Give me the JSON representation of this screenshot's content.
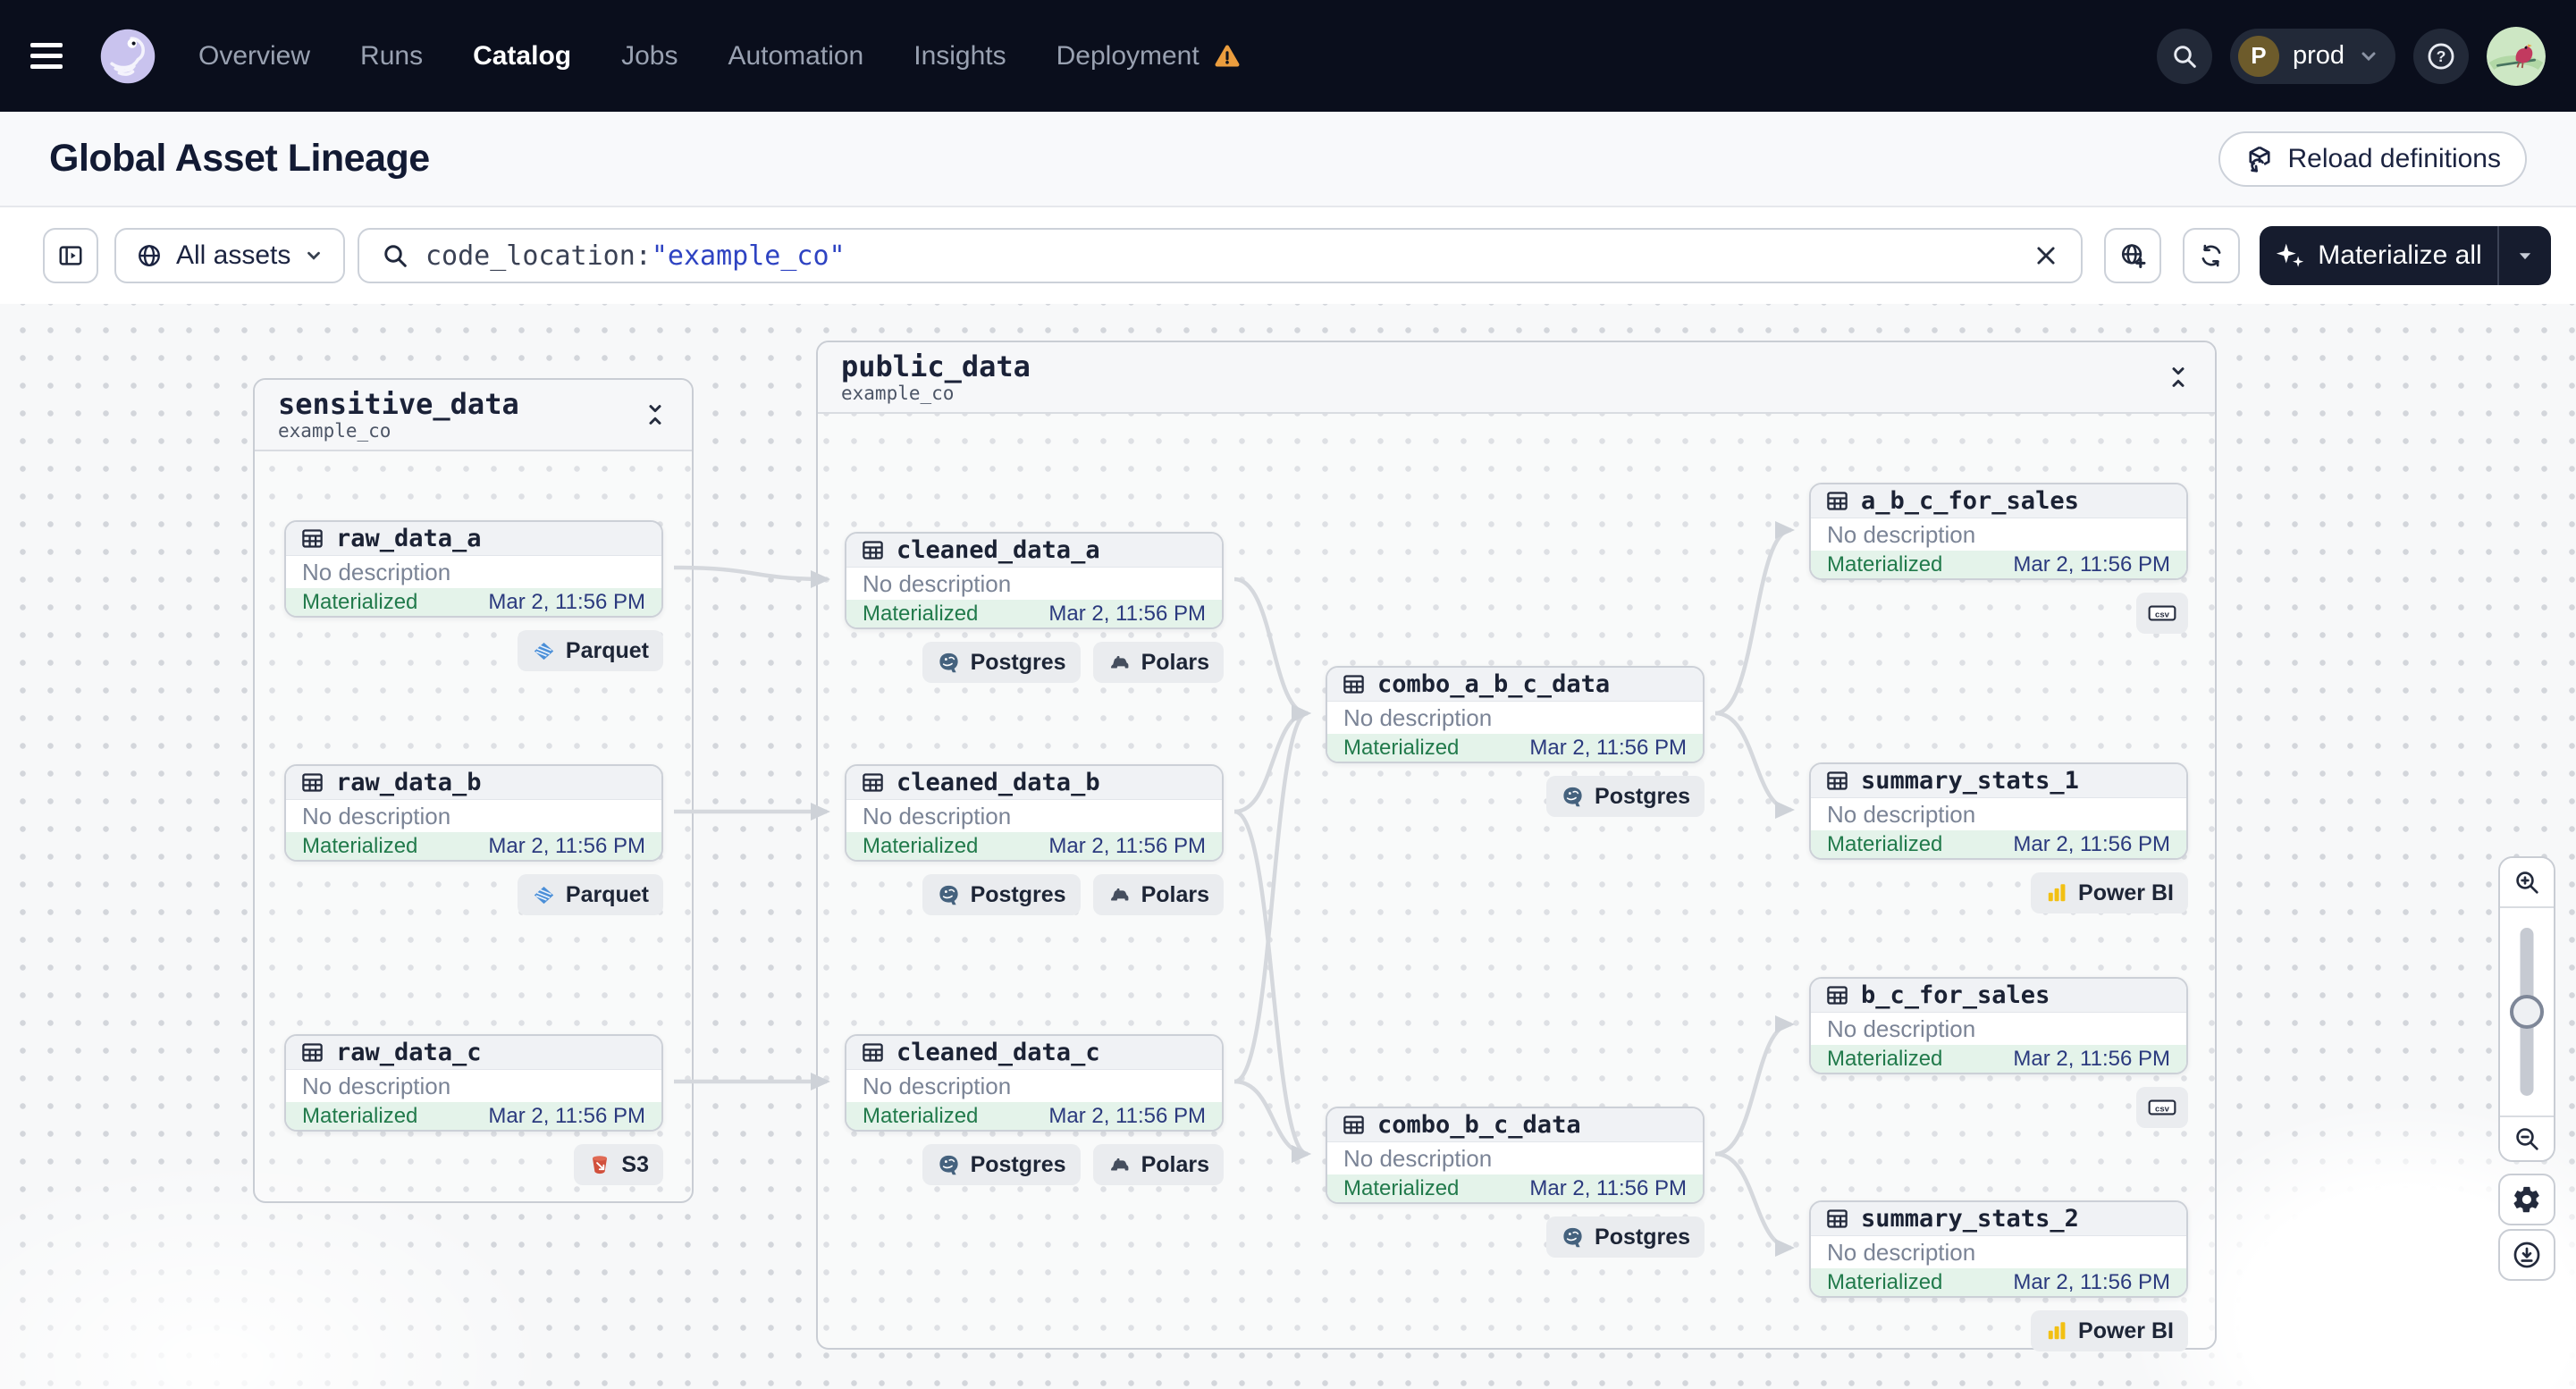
{
  "nav": {
    "menu_icon": "hamburger-menu-icon",
    "logo_icon": "dagster-logo",
    "items": [
      {
        "label": "Overview"
      },
      {
        "label": "Runs"
      },
      {
        "label": "Catalog",
        "active": true
      },
      {
        "label": "Jobs"
      },
      {
        "label": "Automation"
      },
      {
        "label": "Insights"
      },
      {
        "label": "Deployment",
        "warning": true
      }
    ],
    "search_icon": "search-icon",
    "environment": {
      "initial": "P",
      "label": "prod"
    },
    "help_icon": "help-icon",
    "avatar_icon": "user-avatar"
  },
  "header": {
    "title": "Global Asset Lineage",
    "reload_button": {
      "label": "Reload definitions",
      "icon": "reload-definitions-icon"
    }
  },
  "toolbar": {
    "panel_toggle_icon": "open-panel-icon",
    "scope": {
      "icon": "globe-icon",
      "label": "All assets",
      "caret_icon": "chevron-down-icon"
    },
    "search": {
      "icon": "search-icon",
      "value_key": "code_location:",
      "value_term": "\"example_co\"",
      "clear_icon": "close-icon"
    },
    "isolate_icon": "globe-add-icon",
    "refresh_icon": "refresh-icon",
    "materialize": {
      "icon": "sparkles-icon",
      "label": "Materialize all",
      "caret_icon": "chevron-down-icon"
    }
  },
  "graph": {
    "groups": [
      {
        "id": "sensitive_data",
        "name": "sensitive_data",
        "location": "example_co",
        "collapse_icon": "collapse-icon"
      },
      {
        "id": "public_data",
        "name": "public_data",
        "location": "example_co",
        "collapse_icon": "collapse-icon"
      }
    ],
    "assets": [
      {
        "id": "raw_data_a",
        "name": "raw_data_a",
        "group": "sensitive_data",
        "description": "No description",
        "status": "Materialized",
        "timestamp": "Mar 2, 11:56 PM",
        "tags": [
          {
            "label": "Parquet",
            "icon": "parquet-icon"
          }
        ]
      },
      {
        "id": "raw_data_b",
        "name": "raw_data_b",
        "group": "sensitive_data",
        "description": "No description",
        "status": "Materialized",
        "timestamp": "Mar 2, 11:56 PM",
        "tags": [
          {
            "label": "Parquet",
            "icon": "parquet-icon"
          }
        ]
      },
      {
        "id": "raw_data_c",
        "name": "raw_data_c",
        "group": "sensitive_data",
        "description": "No description",
        "status": "Materialized",
        "timestamp": "Mar 2, 11:56 PM",
        "tags": [
          {
            "label": "S3",
            "icon": "s3-bucket-icon"
          }
        ]
      },
      {
        "id": "cleaned_data_a",
        "name": "cleaned_data_a",
        "group": "public_data",
        "description": "No description",
        "status": "Materialized",
        "timestamp": "Mar 2, 11:56 PM",
        "tags": [
          {
            "label": "Postgres",
            "icon": "postgres-icon"
          },
          {
            "label": "Polars",
            "icon": "polars-icon"
          }
        ]
      },
      {
        "id": "cleaned_data_b",
        "name": "cleaned_data_b",
        "group": "public_data",
        "description": "No description",
        "status": "Materialized",
        "timestamp": "Mar 2, 11:56 PM",
        "tags": [
          {
            "label": "Postgres",
            "icon": "postgres-icon"
          },
          {
            "label": "Polars",
            "icon": "polars-icon"
          }
        ]
      },
      {
        "id": "cleaned_data_c",
        "name": "cleaned_data_c",
        "group": "public_data",
        "description": "No description",
        "status": "Materialized",
        "timestamp": "Mar 2, 11:56 PM",
        "tags": [
          {
            "label": "Postgres",
            "icon": "postgres-icon"
          },
          {
            "label": "Polars",
            "icon": "polars-icon"
          }
        ]
      },
      {
        "id": "combo_a_b_c_data",
        "name": "combo_a_b_c_data",
        "group": "public_data",
        "description": "No description",
        "status": "Materialized",
        "timestamp": "Mar 2, 11:56 PM",
        "tags": [
          {
            "label": "Postgres",
            "icon": "postgres-icon"
          }
        ]
      },
      {
        "id": "combo_b_c_data",
        "name": "combo_b_c_data",
        "group": "public_data",
        "description": "No description",
        "status": "Materialized",
        "timestamp": "Mar 2, 11:56 PM",
        "tags": [
          {
            "label": "Postgres",
            "icon": "postgres-icon"
          }
        ]
      },
      {
        "id": "a_b_c_for_sales",
        "name": "a_b_c_for_sales",
        "group": "public_data",
        "description": "No description",
        "status": "Materialized",
        "timestamp": "Mar 2, 11:56 PM",
        "tags": [
          {
            "label": "",
            "icon": "csv-icon"
          }
        ]
      },
      {
        "id": "summary_stats_1",
        "name": "summary_stats_1",
        "group": "public_data",
        "description": "No description",
        "status": "Materialized",
        "timestamp": "Mar 2, 11:56 PM",
        "tags": [
          {
            "label": "Power BI",
            "icon": "powerbi-icon"
          }
        ]
      },
      {
        "id": "b_c_for_sales",
        "name": "b_c_for_sales",
        "group": "public_data",
        "description": "No description",
        "status": "Materialized",
        "timestamp": "Mar 2, 11:56 PM",
        "tags": [
          {
            "label": "",
            "icon": "csv-icon"
          }
        ]
      },
      {
        "id": "summary_stats_2",
        "name": "summary_stats_2",
        "group": "public_data",
        "description": "No description",
        "status": "Materialized",
        "timestamp": "Mar 2, 11:56 PM",
        "tags": [
          {
            "label": "Power BI",
            "icon": "powerbi-icon"
          }
        ]
      }
    ],
    "edges": [
      [
        "raw_data_a",
        "cleaned_data_a"
      ],
      [
        "raw_data_b",
        "cleaned_data_b"
      ],
      [
        "raw_data_c",
        "cleaned_data_c"
      ],
      [
        "cleaned_data_a",
        "combo_a_b_c_data"
      ],
      [
        "cleaned_data_b",
        "combo_a_b_c_data"
      ],
      [
        "cleaned_data_c",
        "combo_a_b_c_data"
      ],
      [
        "cleaned_data_b",
        "combo_b_c_data"
      ],
      [
        "cleaned_data_c",
        "combo_b_c_data"
      ],
      [
        "combo_a_b_c_data",
        "a_b_c_for_sales"
      ],
      [
        "combo_a_b_c_data",
        "summary_stats_1"
      ],
      [
        "combo_b_c_data",
        "b_c_for_sales"
      ],
      [
        "combo_b_c_data",
        "summary_stats_2"
      ]
    ]
  },
  "controls": {
    "zoom_in_icon": "zoom-in-icon",
    "zoom_slider": "zoom-slider",
    "zoom_out_icon": "zoom-out-icon",
    "settings_icon": "settings-gear-icon",
    "download_icon": "download-icon"
  }
}
